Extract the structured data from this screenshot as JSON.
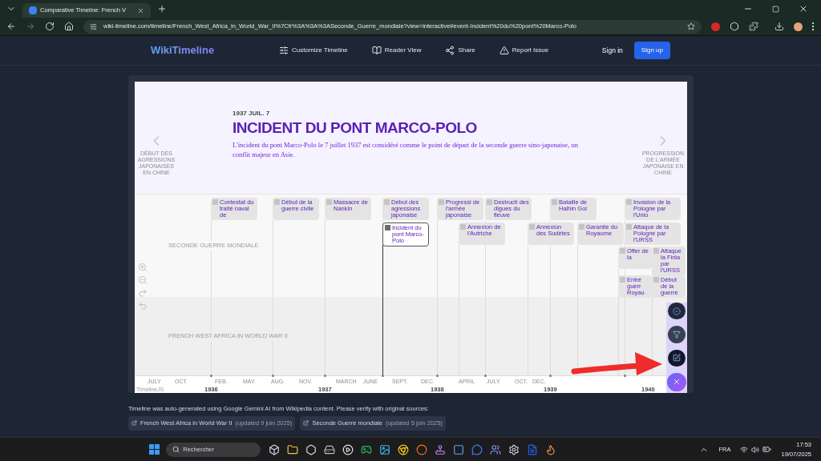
{
  "browser": {
    "tab_title": "Comparative Timeline: French V",
    "url": "wiki-timeline.com/timeline/French_West_Africa_in_World_War_II%7Cfr%3A%3A%3ASeconde_Guerre_mondiale?view=interactive#event-Incident%20du%20pont%20Marco-Polo"
  },
  "site_header": {
    "logo": "WikiTimeline",
    "nav": [
      {
        "kind": "customize",
        "label": "Customize Timeline"
      },
      {
        "kind": "reader",
        "label": "Reader View"
      },
      {
        "kind": "share",
        "label": "Share"
      },
      {
        "kind": "report",
        "label": "Report Issue"
      }
    ],
    "sign_in": "Sign in",
    "sign_up": "Sign up"
  },
  "timeline": {
    "date": "1937 JUIL. 7",
    "headline": "INCIDENT DU PONT MARCO-POLO",
    "text": "L'incident du pont Marco-Polo le 7 juillet 1937 est considéré comme le point de départ de la seconde guerre sino-japonaise, un conflit majeur en Asie.",
    "prev_label": "DÉBUT DES AGRESSIONS JAPONAISES EN CHINE",
    "next_label": "PROGRESSION DE L'ARMÉE JAPONAISE EN CHINE",
    "lanes": [
      "SECONDE GUERRE MONDIALE",
      "FRENCH WEST AFRICA IN WORLD WAR II"
    ],
    "events": [
      {
        "title": "Contestat du traité naval de",
        "selected": false
      },
      {
        "title": "Début de la guerre civile",
        "selected": false
      },
      {
        "title": "Massacre de Nankin",
        "selected": false
      },
      {
        "title": "Début des agressions japonaise",
        "selected": false
      },
      {
        "title": "Progressi de l'armée japonaise",
        "selected": false
      },
      {
        "title": "Destructi des digues du fleuve",
        "selected": false
      },
      {
        "title": "Bataille de Halhin Gol",
        "selected": false
      },
      {
        "title": "Invasion de la Pologne par l'Unio",
        "selected": false
      },
      {
        "title": "Incident du pont Marco-Polo",
        "selected": true
      },
      {
        "title": "Annexion de l'Autriche",
        "selected": false
      },
      {
        "title": "Annexion des Sudètes",
        "selected": false
      },
      {
        "title": "Garantie du Royaume",
        "selected": false
      },
      {
        "title": "Attaque de la Pologne par l'URSS",
        "selected": false
      },
      {
        "title": "Offer de la",
        "selected": false
      },
      {
        "title": "Attaque la Finla par l'URSS",
        "selected": false
      },
      {
        "title": "Entré guerr Royau",
        "selected": false
      },
      {
        "title": "Début de la guerre",
        "selected": false
      }
    ],
    "axis": {
      "months": [
        "JULY",
        "OCT.",
        "FEB.",
        "MAY",
        "AUG.",
        "NOV.",
        "MARCH",
        "JUNE",
        "SEPT.",
        "DEC.",
        "APRIL",
        "JULY",
        "OCT.",
        "DEC."
      ],
      "years": [
        "1936",
        "1937",
        "1938",
        "1939",
        "1940"
      ]
    },
    "credit": "TimelineJS"
  },
  "footer": {
    "note": "Timeline was auto-generated using Google Gemini AI from Wikipedia content. Please verify with original sources:",
    "sources": [
      {
        "title": "French West Africa in World War II",
        "updated": "(updated 9 juin 2025)"
      },
      {
        "title": "Seconde Guerre mondiale",
        "updated": "(updated 5 juin 2025)"
      }
    ]
  },
  "taskbar": {
    "search_placeholder": "Rechercher",
    "language": "FRA",
    "time": "17:53",
    "date": "19/07/2025"
  }
}
